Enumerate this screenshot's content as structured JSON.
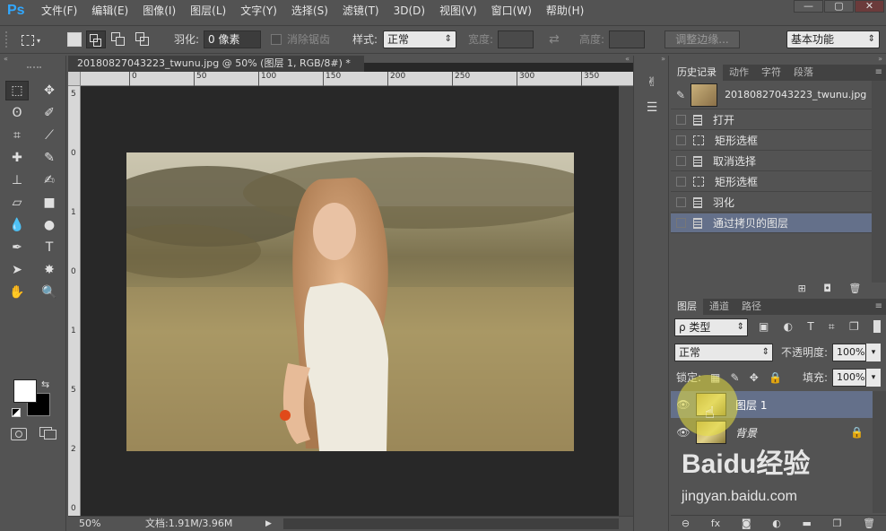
{
  "app": {
    "logo": "Ps"
  },
  "menus": [
    "文件(F)",
    "编辑(E)",
    "图像(I)",
    "图层(L)",
    "文字(Y)",
    "选择(S)",
    "滤镜(T)",
    "3D(D)",
    "视图(V)",
    "窗口(W)",
    "帮助(H)"
  ],
  "window_controls": [
    "—",
    "▢",
    "✕"
  ],
  "options": {
    "feather_label": "羽化:",
    "feather_value": "0 像素",
    "antialias_label": "消除锯齿",
    "style_label": "样式:",
    "style_value": "正常",
    "width_label": "宽度:",
    "height_label": "高度:",
    "refine_edge": "调整边缘...",
    "workspace": "基本功能"
  },
  "document": {
    "tab_title": "20180827043223_twunu.jpg @ 50% (图层 1, RGB/8#) *",
    "tab_close": "×",
    "ruler_top": [
      "0",
      "50",
      "100",
      "150",
      "200",
      "250",
      "300",
      "350"
    ],
    "ruler_left": [
      "5",
      "0",
      "1",
      "0",
      "1",
      "5",
      "2",
      "0"
    ]
  },
  "status": {
    "zoom": "50%",
    "doc_size": "文档:1.91M/3.96M"
  },
  "history": {
    "tabs": [
      "历史记录",
      "动作",
      "字符",
      "段落"
    ],
    "snapshot": "20180827043223_twunu.jpg",
    "items": [
      "打开",
      "矩形选框",
      "取消选择",
      "矩形选框",
      "羽化",
      "通过拷贝的图层"
    ]
  },
  "layers": {
    "tabs": [
      "图层",
      "通道",
      "路径"
    ],
    "filter_label": "ρ 类型",
    "blend_mode": "正常",
    "opacity_label": "不透明度:",
    "opacity_value": "100%",
    "lock_label": "锁定:",
    "fill_label": "填充:",
    "fill_value": "100%",
    "items": [
      {
        "name": "图层 1",
        "selected": true
      },
      {
        "name": "背景",
        "selected": false
      }
    ]
  },
  "watermark": {
    "brand": "Baidu经验",
    "url": "jingyan.baidu.com"
  },
  "colors": {
    "ps_blue": "#31a8ff",
    "selected_row": "#64708a",
    "highlight_circle": "#e8e040"
  }
}
